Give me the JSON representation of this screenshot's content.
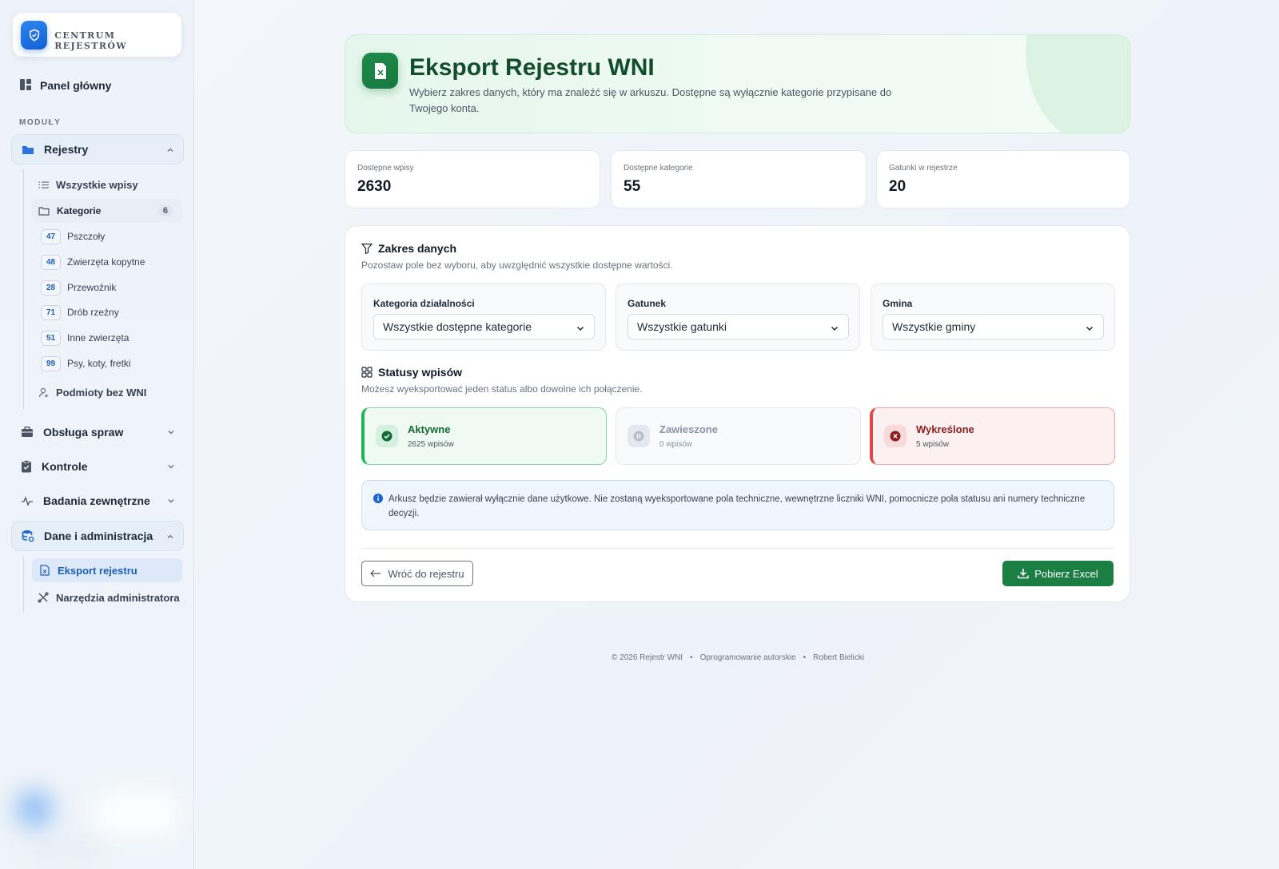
{
  "brand": {
    "name": "CENTRUM REJESTRÓW",
    "icon": "shield-icon"
  },
  "sidebar": {
    "dashboard_label": "Panel główny",
    "section_label": "MODUŁY",
    "groups": {
      "rejestry": "Rejestry",
      "obsluga": "Obsługa spraw",
      "kontrole": "Kontrole",
      "badania": "Badania zewnętrzne",
      "dane": "Dane i administracja"
    },
    "rejestry_items": {
      "all": "Wszystkie wpisy",
      "kategorie": "Kategorie",
      "kategorie_count": "6",
      "bez_wni": "Podmioty bez WNI"
    },
    "categories": [
      {
        "code": "47",
        "label": "Pszczoły"
      },
      {
        "code": "48",
        "label": "Zwierzęta kopytne"
      },
      {
        "code": "28",
        "label": "Przewoźnik"
      },
      {
        "code": "71",
        "label": "Drób rzeźny"
      },
      {
        "code": "51",
        "label": "Inne zwierzęta"
      },
      {
        "code": "99",
        "label": "Psy, koty, fretki"
      }
    ],
    "dane_items": {
      "eksport": "Eksport rejestru",
      "narzedzia": "Narzędzia administratora"
    }
  },
  "hero": {
    "title": "Eksport Rejestru WNI",
    "subtitle": "Wybierz zakres danych, który ma znaleźć się w arkuszu. Dostępne są wyłącznie kategorie przypisane do Twojego konta.",
    "icon": "excel-file-icon"
  },
  "stats": [
    {
      "label": "Dostępne wpisy",
      "value": "2630"
    },
    {
      "label": "Dostępne kategorie",
      "value": "55"
    },
    {
      "label": "Gatunki w rejestrze",
      "value": "20"
    }
  ],
  "zakres": {
    "title": "Zakres danych",
    "desc": "Pozostaw pole bez wyboru, aby uwzględnić wszystkie dostępne wartości.",
    "filters": [
      {
        "label": "Kategoria działalności",
        "value": "Wszystkie dostępne kategorie"
      },
      {
        "label": "Gatunek",
        "value": "Wszystkie gatunki"
      },
      {
        "label": "Gmina",
        "value": "Wszystkie gminy"
      }
    ]
  },
  "statusy": {
    "title": "Statusy wpisów",
    "desc": "Możesz wyeksportować jeden status albo dowolne ich połączenie.",
    "items": [
      {
        "name": "Aktywne",
        "count": "2625 wpisów",
        "selected": true
      },
      {
        "name": "Zawieszone",
        "count": "0 wpisów",
        "selected": false
      },
      {
        "name": "Wykreślone",
        "count": "5 wpisów",
        "selected": true
      }
    ]
  },
  "info": "Arkusz będzie zawierał wyłącznie dane użytkowe. Nie zostaną wyeksportowane pola techniczne, wewnętrzne liczniki WNI, pomocnicze pola statusu ani numery techniczne decyzji.",
  "actions": {
    "back": "Wróć do rejestru",
    "download": "Pobierz Excel"
  },
  "footer": {
    "copyright": "© 2026 Rejestr WNI",
    "software": "Oprogramowanie autorskie",
    "author": "Robert Bielicki",
    "separator": "•"
  },
  "colors": {
    "brand_blue": "#1261d6",
    "excel_green": "#1b7f44",
    "active_green": "#22b357",
    "deleted_red": "#e04848"
  }
}
